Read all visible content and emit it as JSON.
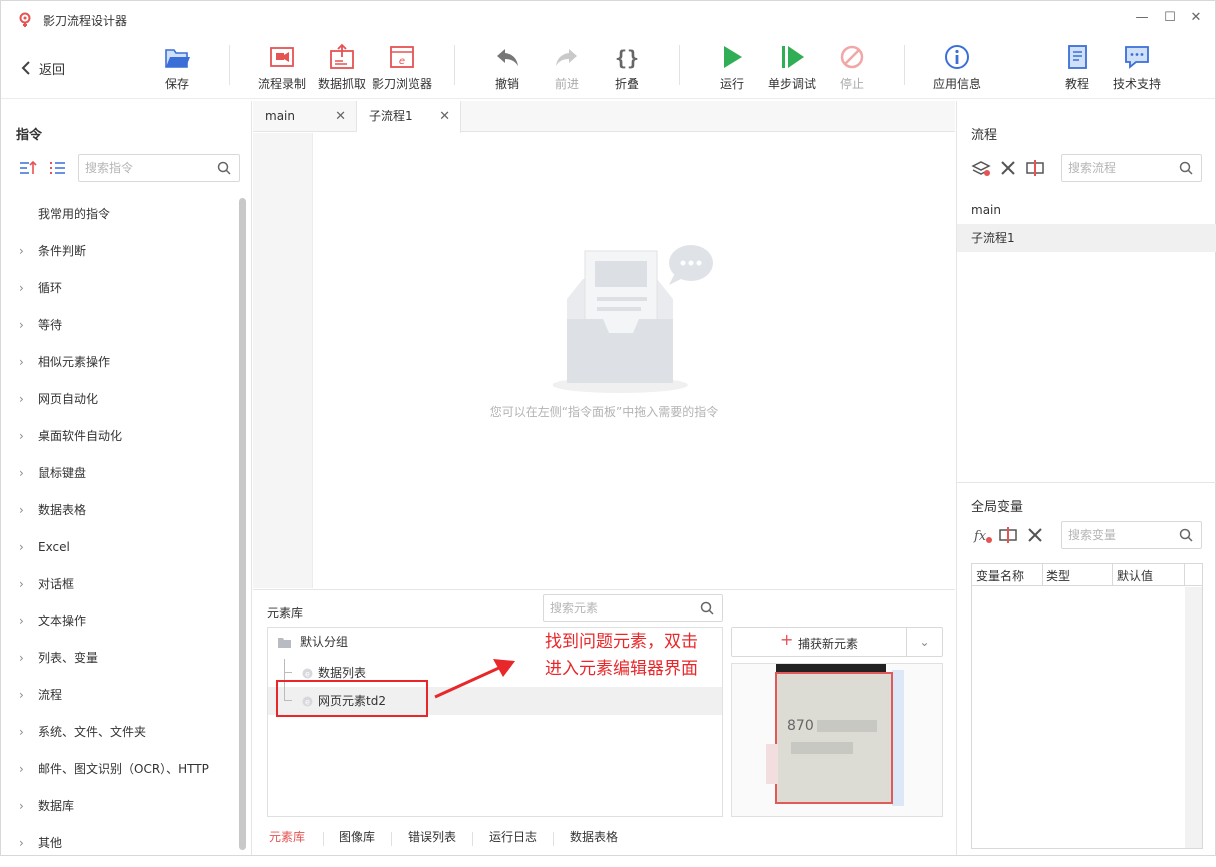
{
  "app": {
    "title": "影刀流程设计器"
  },
  "toolbar": {
    "back": "返回",
    "save": "保存",
    "record": "流程录制",
    "scrape": "数据抓取",
    "browser": "影刀浏览器",
    "undo": "撤销",
    "redo": "前进",
    "fold": "折叠",
    "run": "运行",
    "step": "单步调试",
    "stop": "停止",
    "appinfo": "应用信息",
    "tutorial": "教程",
    "support": "技术支持"
  },
  "left": {
    "title": "指令",
    "search_placeholder": "搜索指令",
    "items": [
      "我常用的指令",
      "条件判断",
      "循环",
      "等待",
      "相似元素操作",
      "网页自动化",
      "桌面软件自动化",
      "鼠标键盘",
      "数据表格",
      "Excel",
      "对话框",
      "文本操作",
      "列表、变量",
      "流程",
      "系统、文件、文件夹",
      "邮件、图文识别（OCR）、HTTP",
      "数据库",
      "其他"
    ]
  },
  "tabs": [
    "main",
    "子流程1"
  ],
  "canvas": {
    "empty_hint": "您可以在左侧“指令面板”中拖入需要的指令"
  },
  "element_lib": {
    "title": "元素库",
    "search_placeholder": "搜索元素",
    "group": "默认分组",
    "items": [
      "数据列表",
      "网页元素td2"
    ],
    "capture": "捕获新元素",
    "preview_text": "870"
  },
  "bottom_tabs": [
    "元素库",
    "图像库",
    "错误列表",
    "运行日志",
    "数据表格"
  ],
  "annotation": {
    "line1": "找到问题元素，双击",
    "line2": "进入元素编辑器界面"
  },
  "right": {
    "flow_title": "流程",
    "flow_search_placeholder": "搜索流程",
    "flows": [
      "main",
      "子流程1"
    ],
    "var_title": "全局变量",
    "var_search_placeholder": "搜索变量",
    "var_columns": [
      "变量名称",
      "类型",
      "默认值"
    ]
  },
  "colors": {
    "accent": "#e55353",
    "run": "#2fae55",
    "info": "#3a6fd8",
    "annotation": "#e8272a"
  }
}
